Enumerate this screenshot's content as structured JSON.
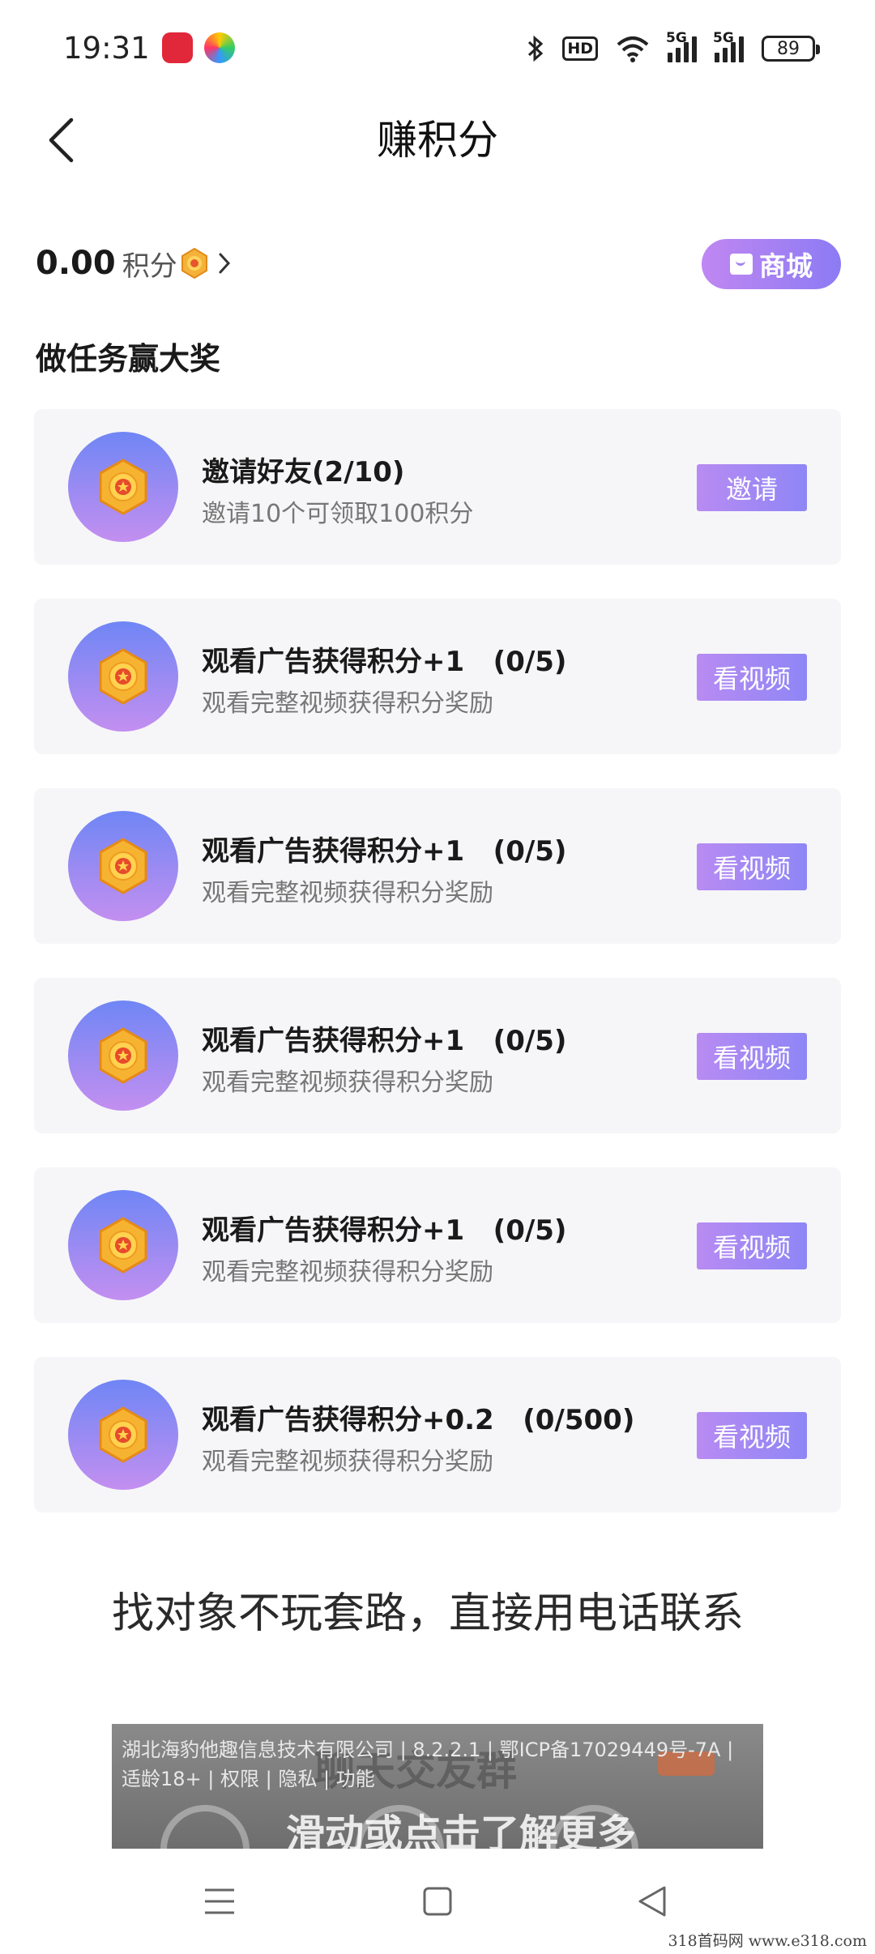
{
  "status_bar": {
    "time": "19:31",
    "battery": "89",
    "hd_label": "HD",
    "network1": "5G",
    "network2": "5G",
    "icons": [
      "app-notification-icon",
      "app-colorful-icon",
      "bluetooth-icon",
      "hd-icon",
      "wifi-icon",
      "signal-icon",
      "signal-icon",
      "battery-icon"
    ]
  },
  "header": {
    "title": "赚积分",
    "back_icon": "back-arrow-icon"
  },
  "points": {
    "value": "0.00",
    "unit": "积分",
    "coin_icon": "coin-icon",
    "chevron_icon": "chevron-right-icon"
  },
  "mall_button": {
    "label": "商城",
    "icon": "shop-bag-icon"
  },
  "section_title": "做任务赢大奖",
  "tasks": [
    {
      "title": "邀请好友(2/10)",
      "subtitle": "邀请10个可领取100积分",
      "button": "邀请"
    },
    {
      "title": "观看广告获得积分+1   (0/5)",
      "subtitle": "观看完整视频获得积分奖励",
      "button": "看视频"
    },
    {
      "title": "观看广告获得积分+1   (0/5)",
      "subtitle": "观看完整视频获得积分奖励",
      "button": "看视频"
    },
    {
      "title": "观看广告获得积分+1   (0/5)",
      "subtitle": "观看完整视频获得积分奖励",
      "button": "看视频"
    },
    {
      "title": "观看广告获得积分+1   (0/5)",
      "subtitle": "观看完整视频获得积分奖励",
      "button": "看视频"
    },
    {
      "title": "观看广告获得积分+0.2   (0/500)",
      "subtitle": "观看完整视频获得积分奖励",
      "button": "看视频"
    }
  ],
  "ad": {
    "title": "找对象不玩套路，直接用电话联系",
    "company_info": "湖北海豹他趣信息技术有限公司 | 8.2.2.1 | 鄂ICP备17029449号-7A | 适龄18+ | 权限 | 隐私 | 功能",
    "overlay_text": "滑动或点击了解更多"
  },
  "nav_bar": {
    "icons": [
      "menu-icon",
      "home-icon",
      "back-triangle-icon"
    ]
  },
  "watermark": "318首码网   www.e318.com",
  "colors": {
    "accent_gradient_start": "#c087f2",
    "accent_gradient_end": "#8c7bf4",
    "card_bg": "#f6f6f8",
    "avatar_top": "#6f86f5",
    "avatar_bottom": "#c38ff0"
  }
}
